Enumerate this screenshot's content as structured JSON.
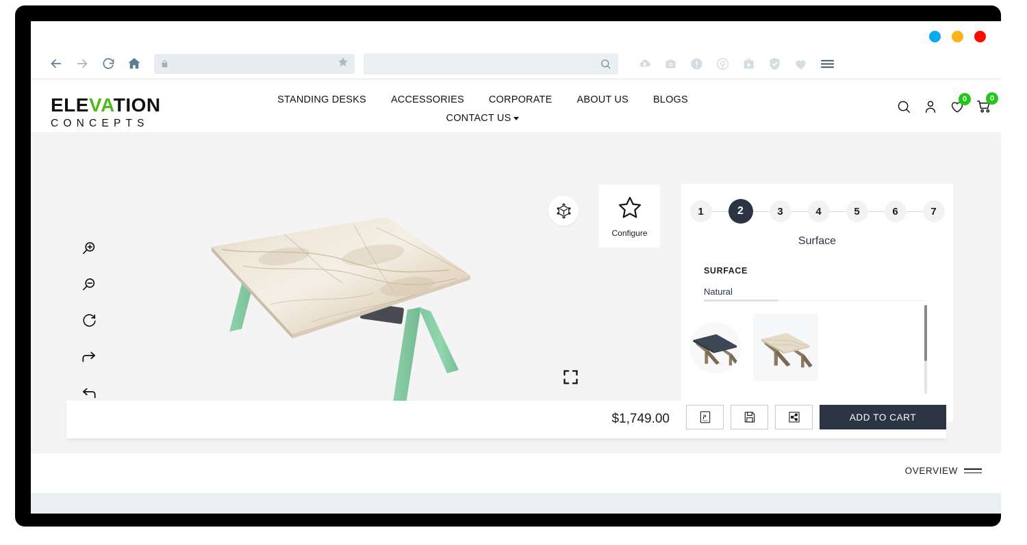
{
  "browser": {
    "back_icon": "arrow-left-icon",
    "forward_icon": "arrow-right-icon",
    "reload_icon": "reload-icon",
    "home_icon": "home-icon",
    "url_value": "",
    "url_placeholder": "",
    "lock_icon": "lock-icon",
    "bookmark_icon": "star-icon",
    "search_value": "",
    "search_placeholder": "",
    "search_icon": "search-icon",
    "extensions": [
      {
        "name": "cloud-upload-icon"
      },
      {
        "name": "camera-icon"
      },
      {
        "name": "alert-octagon-icon"
      },
      {
        "name": "broadcast-icon"
      },
      {
        "name": "video-briefcase-icon"
      },
      {
        "name": "shield-check-icon"
      },
      {
        "name": "heart-icon"
      },
      {
        "name": "menu-icon"
      }
    ],
    "window_dots": [
      {
        "name": "minimize-dot",
        "color": "#0aaaf0"
      },
      {
        "name": "maximize-dot",
        "color": "#fcb316"
      },
      {
        "name": "close-dot",
        "color": "#f80f00"
      }
    ]
  },
  "site": {
    "logo": {
      "line1_a": "ELE",
      "line1_b": "VA",
      "line1_c": "TION",
      "line2": "CONCEPTS",
      "accent_color": "#4cbb17"
    },
    "nav_primary": [
      {
        "label": "STANDING DESKS"
      },
      {
        "label": "ACCESSORIES"
      },
      {
        "label": "CORPORATE"
      },
      {
        "label": "ABOUT US"
      },
      {
        "label": "BLOGS"
      }
    ],
    "nav_secondary": {
      "label": "CONTACT US",
      "has_dropdown": true
    },
    "ghost_text": "",
    "header_icons": [
      {
        "name": "search-icon",
        "badge": null
      },
      {
        "name": "account-icon",
        "badge": null
      },
      {
        "name": "wishlist-heart-icon",
        "badge": "0"
      },
      {
        "name": "cart-icon",
        "badge": "0"
      }
    ],
    "badge_color": "#23c716"
  },
  "viewer": {
    "tools": [
      {
        "name": "zoom-in-icon"
      },
      {
        "name": "zoom-out-icon"
      },
      {
        "name": "reset-rotate-icon"
      },
      {
        "name": "redo-icon"
      },
      {
        "name": "undo-icon"
      }
    ],
    "ar_icon": "ar-view-icon",
    "configure_card": {
      "icon": "star-icon",
      "label": "Configure"
    },
    "fullscreen_icon": "fullscreen-icon",
    "product": {
      "surface_material": "Natural Marble",
      "leg_color": "#8ed2ac",
      "surface_tone": "#e8ddcc"
    }
  },
  "configurator": {
    "steps": [
      {
        "number": "1",
        "active": false
      },
      {
        "number": "2",
        "active": true
      },
      {
        "number": "3",
        "active": false
      },
      {
        "number": "4",
        "active": false
      },
      {
        "number": "5",
        "active": false
      },
      {
        "number": "6",
        "active": false
      },
      {
        "number": "7",
        "active": false
      }
    ],
    "active_step_color": "#2b3442",
    "title": "Surface",
    "group_label": "SURFACE",
    "tabs": [
      {
        "label": "Natural",
        "active": true
      }
    ],
    "swatches": [
      {
        "name": "desk-swatch-dark",
        "selected": false,
        "top_color": "#3b4754",
        "leg_color": "#8b7b62"
      },
      {
        "name": "desk-swatch-marble",
        "selected": true,
        "top_color": "#e3d8c6",
        "leg_color": "#8b7b62"
      }
    ]
  },
  "bottom_bar": {
    "price": "$1,749.00",
    "buttons": [
      {
        "name": "download-pdf-button",
        "icon": "pdf-icon"
      },
      {
        "name": "save-button",
        "icon": "floppy-disk-icon"
      },
      {
        "name": "share-button",
        "icon": "share-icon"
      }
    ],
    "add_to_cart_label": "ADD TO CART",
    "add_to_cart_color": "#2b3442"
  },
  "overview": {
    "label": "OVERVIEW",
    "icon": "lines-icon"
  }
}
